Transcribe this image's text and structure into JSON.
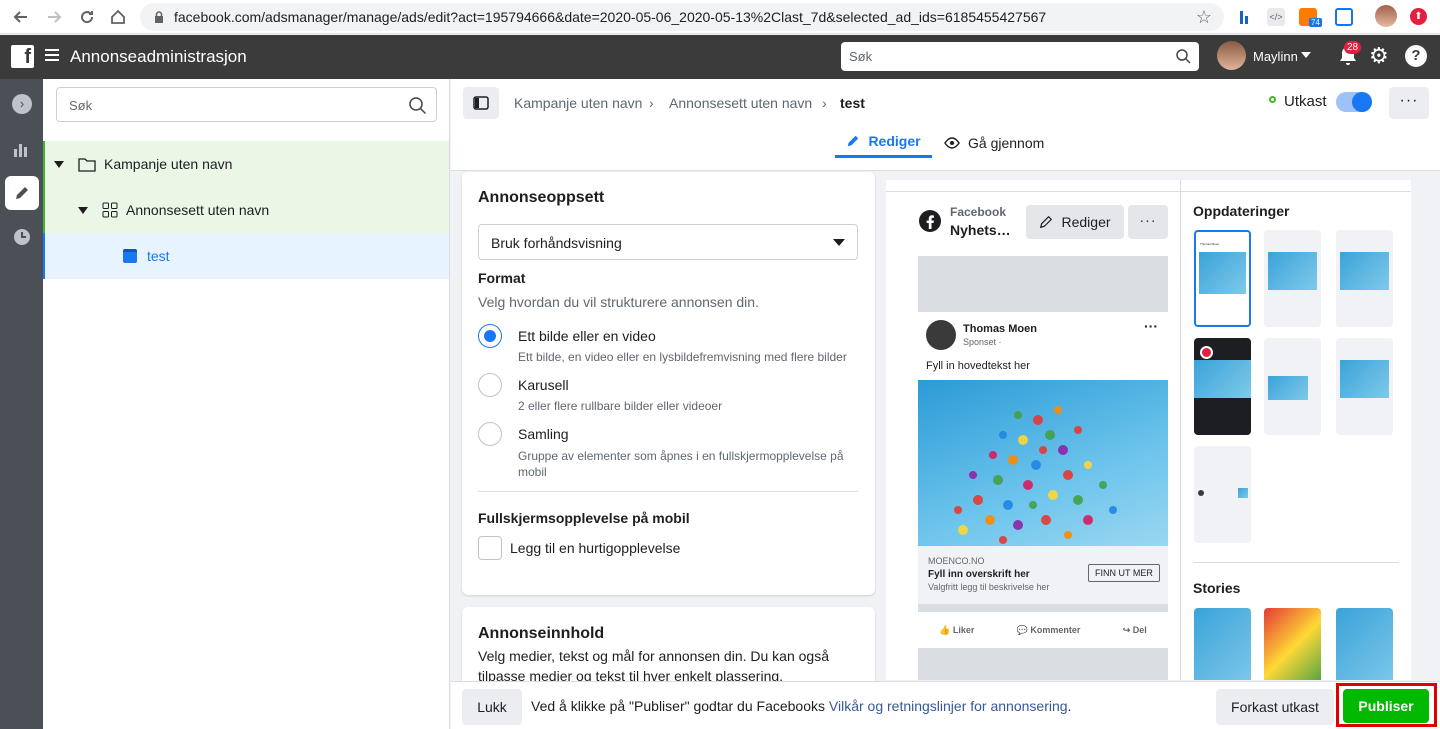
{
  "browser": {
    "url": "facebook.com/adsmanager/manage/ads/edit?act=195794666&date=2020-05-06_2020-05-13%2Clast_7d&selected_ad_ids=6185455427567",
    "ext_badge": "74"
  },
  "header": {
    "title": "Annonseadministrasjon",
    "search_placeholder": "Søk",
    "user_name": "Maylinn",
    "notif_count": "28"
  },
  "tree": {
    "search_placeholder": "Søk",
    "items": [
      {
        "label": "Kampanje uten navn"
      },
      {
        "label": "Annonsesett uten navn"
      },
      {
        "label": "test"
      }
    ]
  },
  "editor": {
    "breadcrumb": [
      "Kampanje uten navn",
      "Annonsesett uten navn",
      "test"
    ],
    "status": "Utkast",
    "tabs": [
      {
        "label": "Rediger"
      },
      {
        "label": "Gå gjennom"
      }
    ]
  },
  "setup": {
    "title": "Annonseoppsett",
    "dropdown_value": "Bruk forhåndsvisning",
    "format_title": "Format",
    "format_desc": "Velg hvordan du vil strukturere annonsen din.",
    "options": [
      {
        "label": "Ett bilde eller en video",
        "desc": "Ett bilde, en video eller en lysbildefremvisning med flere bilder",
        "selected": true
      },
      {
        "label": "Karusell",
        "desc": "2 eller flere rullbare bilder eller videoer",
        "selected": false
      },
      {
        "label": "Samling",
        "desc": "Gruppe av elementer som åpnes i en fullskjermopplevelse på mobil",
        "selected": false
      }
    ],
    "fullscreen_title": "Fullskjermsopplevelse på mobil",
    "fullscreen_checkbox": "Legg til en hurtigopplevelse"
  },
  "content": {
    "title": "Annonseinnhold",
    "desc": "Velg medier, tekst og mål for annonsen din. Du kan også tilpasse medier og tekst til hver enkelt plassering."
  },
  "preview": {
    "platform": "Facebook",
    "placement": "Nyhets…",
    "edit_label": "Rediger",
    "updates_title": "Oppdateringer",
    "stories_title": "Stories",
    "post": {
      "author": "Thomas Moen",
      "sponsored": "Sponset · ",
      "text": "Fyll in hovedtekst her",
      "domain": "MOENCO.NO",
      "headline": "Fyll inn overskrift her",
      "description": "Valgfritt legg til beskrivelse her",
      "cta": "FINN UT MER",
      "like": "Liker",
      "comment": "Kommenter",
      "share": "Del"
    },
    "thumb_author": "Thomas Moen"
  },
  "footer": {
    "close_label": "Lukk",
    "notice": "Ved å klikke på \"Publiser\" godtar du Facebooks ",
    "notice_link": "Vilkår og retningslinjer for annonsering",
    "notice_end": ".",
    "discard_label": "Forkast utkast",
    "publish_label": "Publiser"
  },
  "colors": {
    "accent": "#1877f2",
    "publish": "#00b900",
    "highlight": "#e00000"
  }
}
